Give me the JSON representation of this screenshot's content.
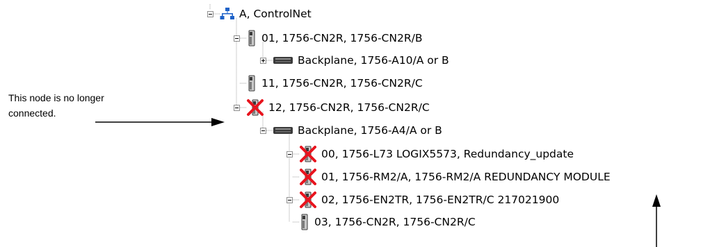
{
  "tree": {
    "nodes": [
      {
        "label": "A, ControlNet",
        "icon": "network-icon",
        "toggle": "minus",
        "faulted": false
      },
      {
        "label": "01, 1756-CN2R, 1756-CN2R/B",
        "icon": "module-icon",
        "toggle": "minus",
        "faulted": false
      },
      {
        "label": "Backplane, 1756-A10/A or B",
        "icon": "backplane-icon",
        "toggle": "plus",
        "faulted": false
      },
      {
        "label": "11, 1756-CN2R, 1756-CN2R/C",
        "icon": "module-icon",
        "toggle": "none",
        "faulted": false
      },
      {
        "label": "12, 1756-CN2R, 1756-CN2R/C",
        "icon": "module-icon",
        "toggle": "minus",
        "faulted": true
      },
      {
        "label": "Backplane, 1756-A4/A or B",
        "icon": "backplane-icon",
        "toggle": "minus",
        "faulted": false
      },
      {
        "label": "00, 1756-L73 LOGIX5573, Redundancy_update",
        "icon": "module-icon",
        "toggle": "minus",
        "faulted": true
      },
      {
        "label": "01, 1756-RM2/A, 1756-RM2/A REDUNDANCY MODULE",
        "icon": "module-icon",
        "toggle": "none",
        "faulted": true
      },
      {
        "label": "02, 1756-EN2TR, 1756-EN2TR/C 217021900",
        "icon": "module-icon",
        "toggle": "minus",
        "faulted": true
      },
      {
        "label": "03, 1756-CN2R, 1756-CN2R/C",
        "icon": "module-icon",
        "toggle": "none",
        "faulted": false
      }
    ]
  },
  "annotation": {
    "text": "This node is no longer connected."
  },
  "colors": {
    "connector": "#a0a0a0",
    "fault_x": "#e8141e",
    "network": "#1e62c8",
    "module_body": "#c9c9c9",
    "module_dark": "#3a3a3a",
    "arrow": "#000000"
  }
}
